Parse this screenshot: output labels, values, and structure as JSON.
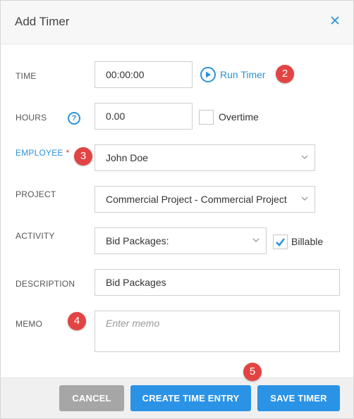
{
  "dialog": {
    "title": "Add Timer",
    "close_icon": "close-icon"
  },
  "colors": {
    "accent": "#2b93d8",
    "primary_button": "#2b93e6",
    "cancel_button": "#a6a6a6",
    "required": "#e0343b",
    "badge": "#e24444"
  },
  "form": {
    "time": {
      "label": "TIME",
      "value": "00:00:00"
    },
    "run_timer": {
      "label": "Run Timer",
      "icon": "play-circle-icon"
    },
    "hours": {
      "label": "HOURS",
      "help_icon": "?",
      "value": "0.00"
    },
    "overtime": {
      "label": "Overtime",
      "checked": false
    },
    "employee": {
      "label": "EMPLOYEE",
      "required_mark": "*",
      "value": "John Doe"
    },
    "project": {
      "label": "PROJECT",
      "value": "Commercial Project - Commercial Project"
    },
    "activity": {
      "label": "ACTIVITY",
      "value": "Bid Packages:"
    },
    "billable": {
      "label": "Billable",
      "checked": true
    },
    "description": {
      "label": "DESCRIPTION",
      "value": "Bid Packages"
    },
    "memo": {
      "label": "MEMO",
      "placeholder": "Enter memo"
    }
  },
  "badges": [
    "2",
    "3",
    "4",
    "5"
  ],
  "footer": {
    "cancel": "CANCEL",
    "create_time_entry": "CREATE TIME ENTRY",
    "save_timer": "SAVE TIMER"
  }
}
